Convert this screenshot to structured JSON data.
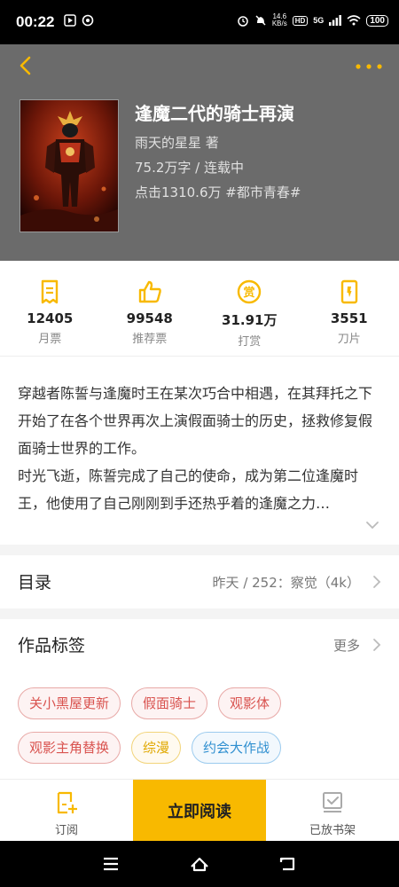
{
  "status_bar": {
    "time": "00:22",
    "speed": "14.6",
    "speed_unit": "KB/s",
    "hd": "HD",
    "network": "5G",
    "battery": "100"
  },
  "book": {
    "title": "逢魔二代的骑士再演",
    "author": "雨天的星星  著",
    "words_status": "75.2万字 / 连载中",
    "clicks_genre": "点击1310.6万  #都市青春#"
  },
  "stats": [
    {
      "icon": "monthly-ticket-icon",
      "value": "12405",
      "label": "月票"
    },
    {
      "icon": "thumbs-up-icon",
      "value": "99548",
      "label": "推荐票"
    },
    {
      "icon": "reward-coin-icon",
      "value": "31.91万",
      "label": "打赏"
    },
    {
      "icon": "blade-card-icon",
      "value": "3551",
      "label": "刀片"
    }
  ],
  "description": {
    "para1": "穿越者陈誓与逢魔时王在某次巧合中相遇，在其拜托之下开始了在各个世界再次上演假面骑士的历史，拯救修复假面骑士世界的工作。",
    "para2": "时光飞逝，陈誓完成了自己的使命，成为第二位逢魔时王，他使用了自己刚刚到手还热乎着的逢魔之力…"
  },
  "toc": {
    "title": "目录",
    "latest": "昨天 / 252：察觉（4k）"
  },
  "tags_section": {
    "title": "作品标签",
    "more": "更多",
    "tags": [
      {
        "label": "关小黑屋更新",
        "color": "red"
      },
      {
        "label": "假面骑士",
        "color": "red"
      },
      {
        "label": "观影体",
        "color": "red"
      },
      {
        "label": "观影主角替换",
        "color": "red"
      },
      {
        "label": "综漫",
        "color": "yellow"
      },
      {
        "label": "约会大作战",
        "color": "blue"
      }
    ]
  },
  "bottom_bar": {
    "subscribe": "订阅",
    "read_now": "立即阅读",
    "on_shelf": "已放书架"
  },
  "colors": {
    "accent": "#f8b900",
    "header_bg": "#6b6b6b"
  }
}
